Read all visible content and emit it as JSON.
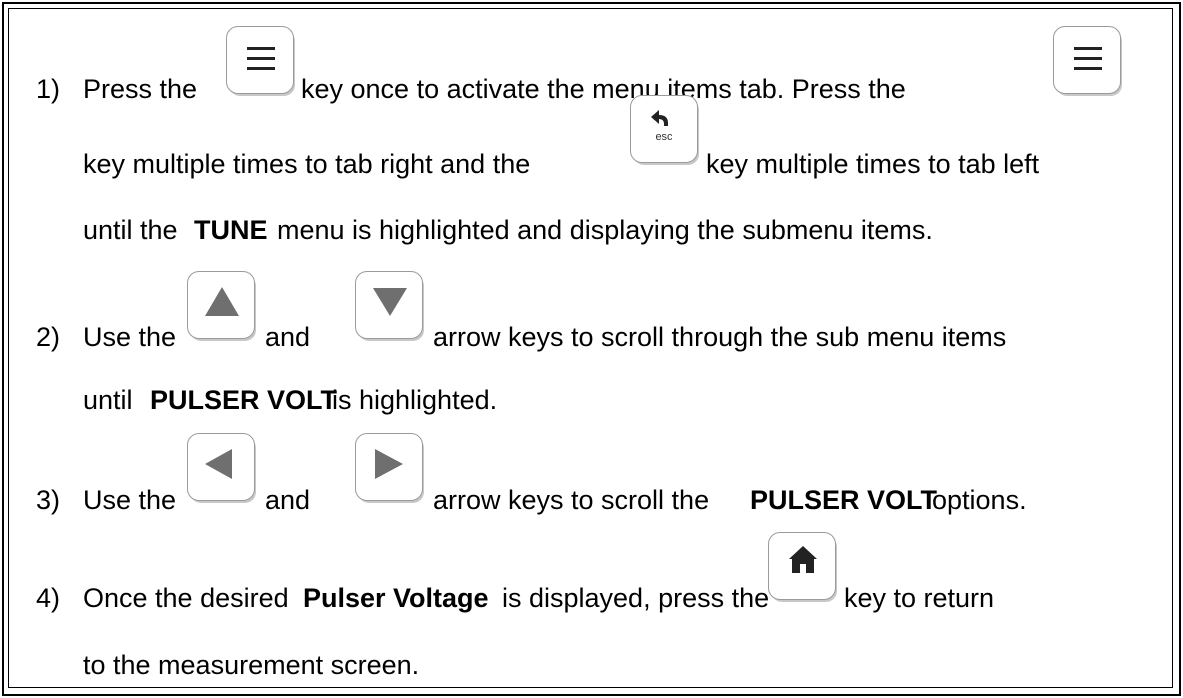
{
  "steps": [
    {
      "num": "1)",
      "l1a": "Press the",
      "l1b": "key once to activate the menu items tab.  Press the",
      "l2a": "key multiple times to tab right and the",
      "l2b": "key multiple times to tab left",
      "l3a": "until the",
      "l3b": "TUNE",
      "l3c": "menu is highlighted and displaying the submenu items."
    },
    {
      "num": "2)",
      "l1a": "Use the",
      "l1b": "and",
      "l1c": "arrow keys to scroll through the sub menu items",
      "l2a": "until",
      "l2b": "PULSER VOLT",
      "l2c": "is highlighted."
    },
    {
      "num": "3)",
      "l1a": "Use the",
      "l1b": "and",
      "l1c": "arrow keys to scroll the",
      "l1d": "PULSER VOLT",
      "l1e": "options."
    },
    {
      "num": "4)",
      "l1a": "Once the desired",
      "l1b": "Pulser Voltage",
      "l1c": "is displayed, press the",
      "l1d": "key to return",
      "l2a": "to the measurement screen."
    }
  ],
  "keys": {
    "esc_label": "esc",
    "menu_icon": "hamburger-menu-icon",
    "esc_icon": "back-arrow-icon",
    "up_icon": "triangle-up-icon",
    "down_icon": "triangle-down-icon",
    "left_icon": "triangle-left-icon",
    "right_icon": "triangle-right-icon",
    "home_icon": "home-icon"
  }
}
